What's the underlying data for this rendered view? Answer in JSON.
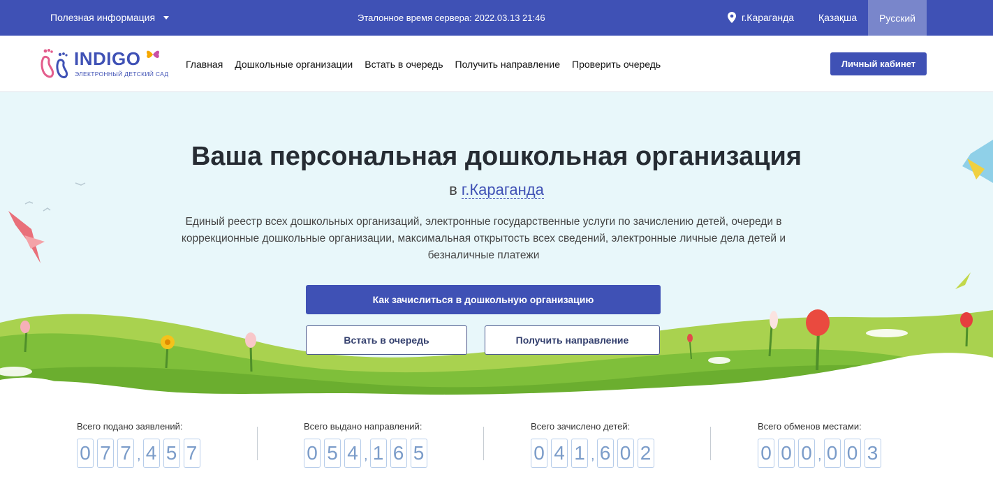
{
  "topbar": {
    "info_label": "Полезная информация",
    "server_time": "Эталонное время сервера: 2022.03.13 21:46",
    "city": "г.Караганда",
    "lang_kz": "Қазақша",
    "lang_ru": "Русский"
  },
  "header": {
    "logo_brand": "INDIGO",
    "logo_sub": "ЭЛЕКТРОННЫЙ ДЕТСКИЙ САД",
    "nav": [
      "Главная",
      "Дошкольные организации",
      "Встать в очередь",
      "Получить направление",
      "Проверить очередь"
    ],
    "cabinet_label": "Личный кабинет"
  },
  "hero": {
    "title": "Ваша персональная дошкольная организация",
    "city_prefix": "в",
    "city_link": "г.Караганда",
    "description": "Единый реестр всех дошкольных организаций, электронные государственные услуги по зачислению детей, очереди в коррекционные дошкольные организации, максимальная открытость всех сведений, электронные личные дела детей и безналичные платежи",
    "primary_button": "Как зачислиться в дошкольную организацию",
    "queue_button": "Встать в очередь",
    "direction_button": "Получить направление"
  },
  "stats": [
    {
      "label": "Всего подано заявлений:",
      "value": "077,457"
    },
    {
      "label": "Всего выдано направлений:",
      "value": "054,165"
    },
    {
      "label": "Всего зачислено детей:",
      "value": "041,602"
    },
    {
      "label": "Всего обменов местами:",
      "value": "000,003"
    }
  ],
  "colors": {
    "primary": "#3f51b5",
    "topbar_active": "#7986cb",
    "hero_bg": "#e8f7fa",
    "grass": "#8cc63f"
  },
  "icons": {
    "location": "map-pin-icon",
    "dropdown": "caret-down-icon"
  }
}
